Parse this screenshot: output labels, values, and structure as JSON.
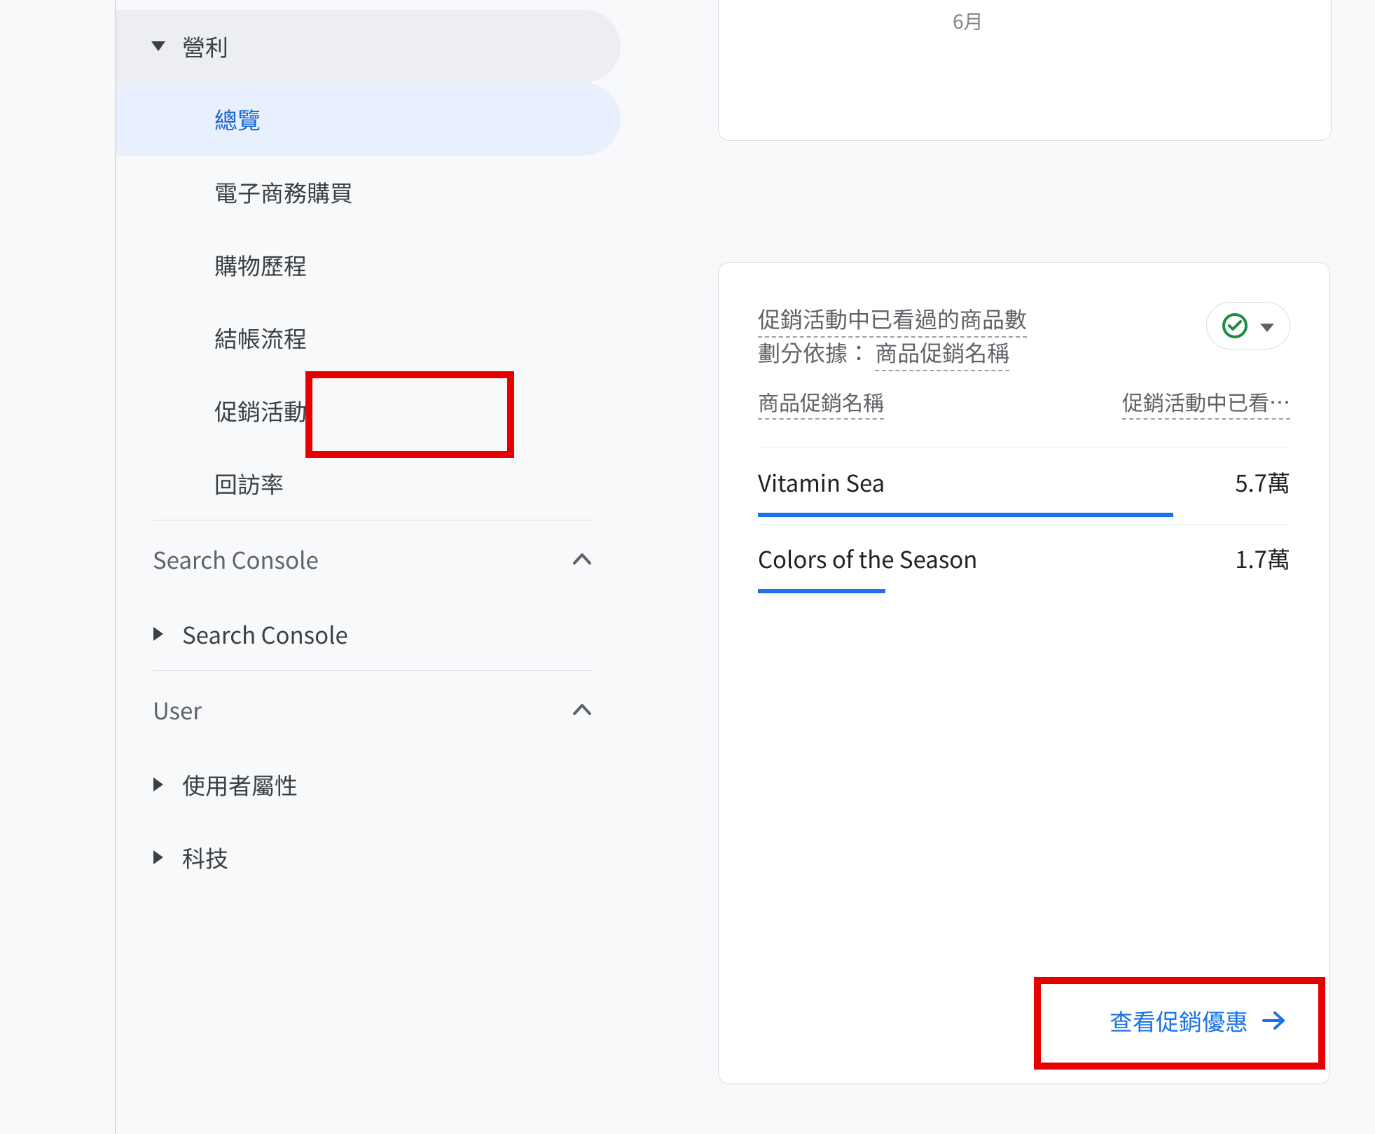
{
  "topFragment": {
    "monthLabel": "6月"
  },
  "sidebar": {
    "monetization": {
      "label": "營利",
      "items": {
        "overview": "總覽",
        "ecommerce": "電子商務購買",
        "shopping": "購物歷程",
        "checkout": "結帳流程",
        "promotions": "促銷活動",
        "retention": "回訪率"
      }
    },
    "searchConsole": {
      "header": "Search Console",
      "item": "Search Console"
    },
    "user": {
      "header": "User",
      "attributes": "使用者屬性",
      "tech": "科技"
    }
  },
  "card": {
    "titleLine1": "促銷活動中已看過的商品數",
    "titleLine2a": "劃分依據：",
    "titleLine2b": "商品促銷名稱",
    "colA": "商品促銷名稱",
    "colB": "促銷活動中已看…",
    "rows": [
      {
        "name": "Vitamin Sea",
        "value": "5.7萬",
        "barPct": 78
      },
      {
        "name": "Colors of the Season",
        "value": "1.7萬",
        "barPct": 24
      }
    ],
    "footerLink": "查看促銷優惠"
  }
}
